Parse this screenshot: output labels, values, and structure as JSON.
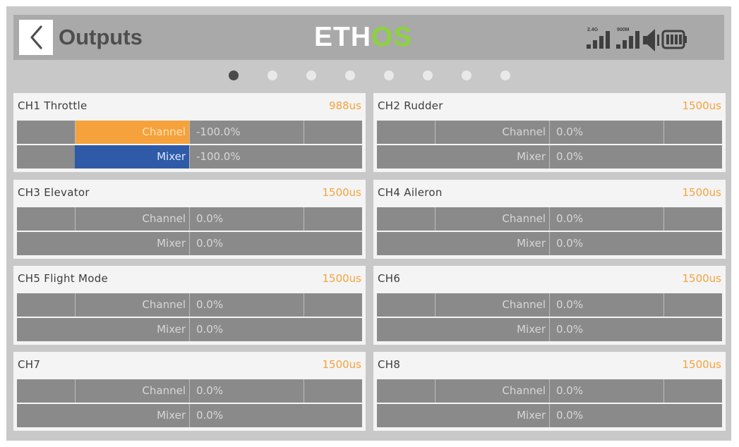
{
  "header": {
    "title": "Outputs",
    "logo_white": "ETH",
    "logo_green": "OS",
    "rf_24_label": "2.4G",
    "rf_900_label": "900M",
    "icons": [
      "back-icon",
      "signal-24g-icon",
      "signal-900m-icon",
      "volume-icon",
      "battery-icon"
    ]
  },
  "pager": {
    "page_count": 8,
    "active_index": 0
  },
  "labels": {
    "channel": "Channel",
    "mixer": "Mixer"
  },
  "colors": {
    "channel_fill": "#f5a23c",
    "mixer_fill": "#2e5aa8",
    "value_text": "#f5a23c",
    "logo_green": "#8bd33a"
  },
  "channels": [
    {
      "id": "ch1",
      "name": "CH1  Throttle",
      "output": "988us",
      "channel_value": "-100.0%",
      "mixer_value": "-100.0%",
      "channel_level": -1.0,
      "mixer_level": -1.0
    },
    {
      "id": "ch2",
      "name": "CH2  Rudder",
      "output": "1500us",
      "channel_value": "0.0%",
      "mixer_value": "0.0%",
      "channel_level": 0,
      "mixer_level": 0
    },
    {
      "id": "ch3",
      "name": "CH3  Elevator",
      "output": "1500us",
      "channel_value": "0.0%",
      "mixer_value": "0.0%",
      "channel_level": 0,
      "mixer_level": 0
    },
    {
      "id": "ch4",
      "name": "CH4  Aileron",
      "output": "1500us",
      "channel_value": "0.0%",
      "mixer_value": "0.0%",
      "channel_level": 0,
      "mixer_level": 0
    },
    {
      "id": "ch5",
      "name": "CH5  Flight Mode",
      "output": "1500us",
      "channel_value": "0.0%",
      "mixer_value": "0.0%",
      "channel_level": 0,
      "mixer_level": 0
    },
    {
      "id": "ch6",
      "name": "CH6",
      "output": "1500us",
      "channel_value": "0.0%",
      "mixer_value": "0.0%",
      "channel_level": 0,
      "mixer_level": 0
    },
    {
      "id": "ch7",
      "name": "CH7",
      "output": "1500us",
      "channel_value": "0.0%",
      "mixer_value": "0.0%",
      "channel_level": 0,
      "mixer_level": 0
    },
    {
      "id": "ch8",
      "name": "CH8",
      "output": "1500us",
      "channel_value": "0.0%",
      "mixer_value": "0.0%",
      "channel_level": 0,
      "mixer_level": 0
    }
  ]
}
